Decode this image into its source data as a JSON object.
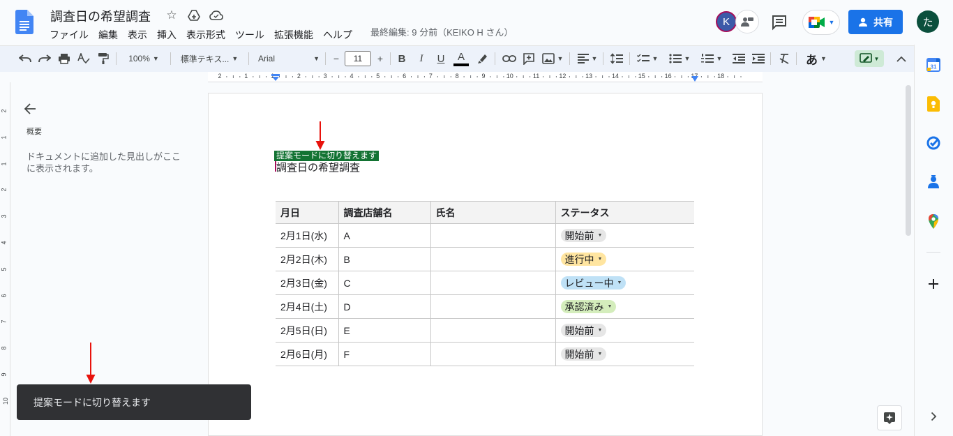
{
  "document": {
    "title": "調査日の希望調査",
    "last_edit": "最終編集: 9 分前（KEIKO H さん）",
    "heading": "調査日の希望調査"
  },
  "menu": [
    "ファイル",
    "編集",
    "表示",
    "挿入",
    "表示形式",
    "ツール",
    "拡張機能",
    "ヘルプ"
  ],
  "header": {
    "avatar_letter": "K",
    "share_label": "共有",
    "user_initial": "た"
  },
  "toolbar": {
    "zoom": "100%",
    "style": "標準テキス...",
    "font": "Arial",
    "font_size": "11",
    "minus": "−",
    "plus": "+",
    "bold": "B",
    "italic": "I",
    "underline": "U",
    "text_color": "A",
    "input_tool": "あ"
  },
  "ruler": [
    "2",
    "1",
    "1",
    "2",
    "3",
    "4",
    "5",
    "6",
    "7",
    "8",
    "9",
    "10",
    "11",
    "12",
    "13",
    "14",
    "15",
    "16",
    "17",
    "18"
  ],
  "ruler_side": [
    "2",
    "1",
    "1",
    "2",
    "3",
    "4",
    "5",
    "6",
    "7",
    "8",
    "9",
    "10"
  ],
  "outline": {
    "title": "概要",
    "message": "ドキュメントに追加した見出しがここに表示されます。"
  },
  "annotation_label": "提案モードに切り替えます",
  "table": {
    "headers": [
      "月日",
      "調査店舗名",
      "氏名",
      "ステータス"
    ],
    "rows": [
      {
        "date": "2月1日(水)",
        "store": "A",
        "name": "",
        "status": "開始前",
        "status_color": "#e6e6e6"
      },
      {
        "date": "2月2日(木)",
        "store": "B",
        "name": "",
        "status": "進行中",
        "status_color": "#ffe5a0"
      },
      {
        "date": "2月3日(金)",
        "store": "C",
        "name": "",
        "status": "レビュー中",
        "status_color": "#bfe1f6"
      },
      {
        "date": "2月4日(土)",
        "store": "D",
        "name": "",
        "status": "承認済み",
        "status_color": "#d4edbc"
      },
      {
        "date": "2月5日(日)",
        "store": "E",
        "name": "",
        "status": "開始前",
        "status_color": "#e6e6e6"
      },
      {
        "date": "2月6日(月)",
        "store": "F",
        "name": "",
        "status": "開始前",
        "status_color": "#e6e6e6"
      }
    ]
  },
  "snackbar": "提案モードに切り替えます",
  "colors": {
    "accent": "#1a73e8",
    "suggest_green": "#137333",
    "arrow_red": "#e8120c"
  }
}
